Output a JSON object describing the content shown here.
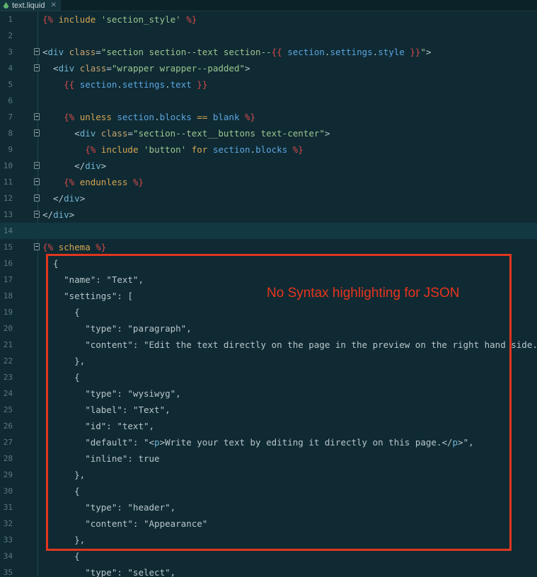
{
  "tab": {
    "filename": "text.liquid",
    "close_glyph": "✕",
    "icon": "liquid-file-icon"
  },
  "annotation": {
    "text": "No Syntax highlighting for JSON",
    "color": "#e0361f"
  },
  "current_line": 14,
  "lines": [
    {
      "n": "1",
      "fold": false,
      "segs": [
        [
          "liq",
          "{% "
        ],
        [
          "kw",
          "include "
        ],
        [
          "str",
          "'section_style' "
        ],
        [
          "liq",
          "%}"
        ]
      ]
    },
    {
      "n": "2",
      "fold": false,
      "segs": []
    },
    {
      "n": "3",
      "fold": true,
      "segs": [
        [
          "plain",
          "<"
        ],
        [
          "tag",
          "div "
        ],
        [
          "attr",
          "class"
        ],
        [
          "plain",
          "="
        ],
        [
          "str",
          "\"section section--text section--"
        ],
        [
          "liq",
          "{{ "
        ],
        [
          "var",
          "section"
        ],
        [
          "plain",
          "."
        ],
        [
          "var",
          "settings"
        ],
        [
          "plain",
          "."
        ],
        [
          "var",
          "style "
        ],
        [
          "liq",
          "}}"
        ],
        [
          "str",
          "\""
        ],
        [
          "plain",
          ">"
        ]
      ]
    },
    {
      "n": "4",
      "fold": true,
      "segs": [
        [
          "plain",
          "  <"
        ],
        [
          "tag",
          "div "
        ],
        [
          "attr",
          "class"
        ],
        [
          "plain",
          "="
        ],
        [
          "str",
          "\"wrapper wrapper--padded\""
        ],
        [
          "plain",
          ">"
        ]
      ]
    },
    {
      "n": "5",
      "fold": false,
      "segs": [
        [
          "plain",
          "    "
        ],
        [
          "liq",
          "{{ "
        ],
        [
          "var",
          "section"
        ],
        [
          "plain",
          "."
        ],
        [
          "var",
          "settings"
        ],
        [
          "plain",
          "."
        ],
        [
          "var",
          "text "
        ],
        [
          "liq",
          "}}"
        ]
      ]
    },
    {
      "n": "6",
      "fold": false,
      "segs": []
    },
    {
      "n": "7",
      "fold": true,
      "segs": [
        [
          "plain",
          "    "
        ],
        [
          "liq",
          "{% "
        ],
        [
          "kw",
          "unless "
        ],
        [
          "var",
          "section"
        ],
        [
          "plain",
          "."
        ],
        [
          "var",
          "blocks "
        ],
        [
          "kw",
          "== "
        ],
        [
          "var",
          "blank "
        ],
        [
          "liq",
          "%}"
        ]
      ]
    },
    {
      "n": "8",
      "fold": true,
      "segs": [
        [
          "plain",
          "      <"
        ],
        [
          "tag",
          "div "
        ],
        [
          "attr",
          "class"
        ],
        [
          "plain",
          "="
        ],
        [
          "str",
          "\"section--text__buttons text-center\""
        ],
        [
          "plain",
          ">"
        ]
      ]
    },
    {
      "n": "9",
      "fold": false,
      "segs": [
        [
          "plain",
          "        "
        ],
        [
          "liq",
          "{% "
        ],
        [
          "kw",
          "include "
        ],
        [
          "str",
          "'button' "
        ],
        [
          "kw",
          "for "
        ],
        [
          "var",
          "section"
        ],
        [
          "plain",
          "."
        ],
        [
          "var",
          "blocks "
        ],
        [
          "liq",
          "%}"
        ]
      ]
    },
    {
      "n": "10",
      "fold": true,
      "segs": [
        [
          "plain",
          "      </"
        ],
        [
          "tag",
          "div"
        ],
        [
          "plain",
          ">"
        ]
      ]
    },
    {
      "n": "11",
      "fold": true,
      "segs": [
        [
          "plain",
          "    "
        ],
        [
          "liq",
          "{% "
        ],
        [
          "kw",
          "endunless "
        ],
        [
          "liq",
          "%}"
        ]
      ]
    },
    {
      "n": "12",
      "fold": true,
      "segs": [
        [
          "plain",
          "  </"
        ],
        [
          "tag",
          "div"
        ],
        [
          "plain",
          ">"
        ]
      ]
    },
    {
      "n": "13",
      "fold": true,
      "segs": [
        [
          "plain",
          "</"
        ],
        [
          "tag",
          "div"
        ],
        [
          "plain",
          ">"
        ]
      ]
    },
    {
      "n": "14",
      "fold": false,
      "segs": []
    },
    {
      "n": "15",
      "fold": true,
      "segs": [
        [
          "liq",
          "{% "
        ],
        [
          "kw",
          "schema "
        ],
        [
          "liq",
          "%}"
        ]
      ]
    },
    {
      "n": "16",
      "fold": false,
      "segs": [
        [
          "json",
          "  {"
        ]
      ]
    },
    {
      "n": "17",
      "fold": false,
      "segs": [
        [
          "json",
          "    \"name\": \"Text\","
        ]
      ]
    },
    {
      "n": "18",
      "fold": false,
      "segs": [
        [
          "json",
          "    \"settings\": ["
        ]
      ]
    },
    {
      "n": "19",
      "fold": false,
      "segs": [
        [
          "json",
          "      {"
        ]
      ]
    },
    {
      "n": "20",
      "fold": false,
      "segs": [
        [
          "json",
          "        \"type\": \"paragraph\","
        ]
      ]
    },
    {
      "n": "21",
      "fold": false,
      "segs": [
        [
          "json",
          "        \"content\": \"Edit the text directly on the page in the preview on the right hand side.\""
        ]
      ]
    },
    {
      "n": "22",
      "fold": false,
      "segs": [
        [
          "json",
          "      },"
        ]
      ]
    },
    {
      "n": "23",
      "fold": false,
      "segs": [
        [
          "json",
          "      {"
        ]
      ]
    },
    {
      "n": "24",
      "fold": false,
      "segs": [
        [
          "json",
          "        \"type\": \"wysiwyg\","
        ]
      ]
    },
    {
      "n": "25",
      "fold": false,
      "segs": [
        [
          "json",
          "        \"label\": \"Text\","
        ]
      ]
    },
    {
      "n": "26",
      "fold": false,
      "segs": [
        [
          "json",
          "        \"id\": \"text\","
        ]
      ]
    },
    {
      "n": "27",
      "fold": false,
      "segs": [
        [
          "json",
          "        \"default\": \""
        ],
        [
          "plain",
          "<"
        ],
        [
          "tag",
          "p"
        ],
        [
          "plain",
          ">"
        ],
        [
          "json",
          "Write your text by editing it directly on this page."
        ],
        [
          "plain",
          "</"
        ],
        [
          "tag",
          "p"
        ],
        [
          "plain",
          ">"
        ],
        [
          "json",
          "\","
        ]
      ]
    },
    {
      "n": "28",
      "fold": false,
      "segs": [
        [
          "json",
          "        \"inline\": true"
        ]
      ]
    },
    {
      "n": "29",
      "fold": false,
      "segs": [
        [
          "json",
          "      },"
        ]
      ]
    },
    {
      "n": "30",
      "fold": false,
      "segs": [
        [
          "json",
          "      {"
        ]
      ]
    },
    {
      "n": "31",
      "fold": false,
      "segs": [
        [
          "json",
          "        \"type\": \"header\","
        ]
      ]
    },
    {
      "n": "32",
      "fold": false,
      "segs": [
        [
          "json",
          "        \"content\": \"Appearance\""
        ]
      ]
    },
    {
      "n": "33",
      "fold": false,
      "segs": [
        [
          "json",
          "      },"
        ]
      ]
    },
    {
      "n": "34",
      "fold": false,
      "segs": [
        [
          "json",
          "      {"
        ]
      ]
    },
    {
      "n": "35",
      "fold": false,
      "segs": [
        [
          "json",
          "        \"type\": \"select\","
        ]
      ]
    }
  ]
}
